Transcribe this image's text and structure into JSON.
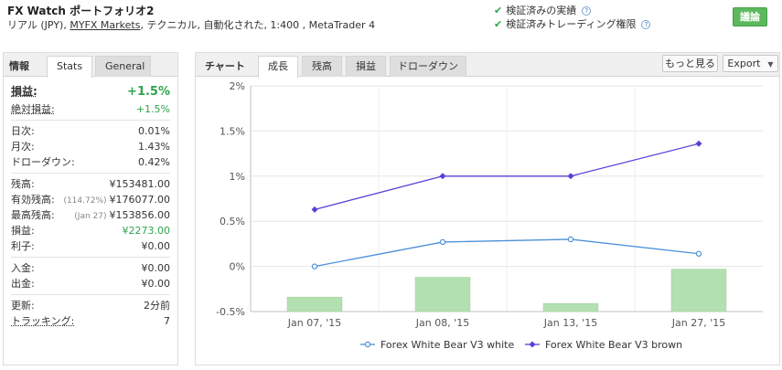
{
  "header": {
    "account_name": "FX Watch ポートフォリオ2",
    "meta_prefix": "リアル (JPY), ",
    "broker_link": "MYFX Markets",
    "meta_suffix": ", テクニカル, 自動化された, 1:400 , MetaTrader 4",
    "verifications": [
      "検証済みの実績",
      "検証済みトレーディング権限"
    ],
    "help_glyph": "?",
    "follow_button": "議論"
  },
  "left_panel": {
    "title": "情報",
    "tabs": [
      "Stats",
      "General"
    ],
    "stats": {
      "gain_label": "損益:",
      "gain_value": "+1.5%",
      "abs_gain_label": "絶対損益:",
      "abs_gain_value": "+1.5%",
      "daily_label": "日次:",
      "daily_value": "0.01%",
      "monthly_label": "月次:",
      "monthly_value": "1.43%",
      "drawdown_label": "ドローダウン:",
      "drawdown_value": "0.42%",
      "balance_label": "残高:",
      "balance_value": "¥153481.00",
      "equity_label": "有効残高:",
      "equity_pct": "(114.72%)",
      "equity_value": "¥176077.00",
      "highest_label": "最高残高:",
      "highest_date": "(Jan 27)",
      "highest_value": "¥153856.00",
      "profit_label": "損益:",
      "profit_value": "¥2273.00",
      "interest_label": "利子:",
      "interest_value": "¥0.00",
      "deposits_label": "入金:",
      "deposits_value": "¥0.00",
      "withdrawals_label": "出金:",
      "withdrawals_value": "¥0.00",
      "updated_label": "更新:",
      "updated_value": "2分前",
      "tracking_label": "トラッキング:",
      "tracking_value": "7"
    }
  },
  "chart_panel": {
    "title": "チャート",
    "tabs": [
      "成長",
      "残高",
      "損益",
      "ドローダウン"
    ],
    "more_button": "もっと見る",
    "export_button": "Export",
    "export_caret": "▼"
  },
  "chart_data": {
    "type": "line",
    "categories": [
      "Jan 07, '15",
      "Jan 08, '15",
      "Jan 13, '15",
      "Jan 27, '15"
    ],
    "yticks": [
      "2%",
      "1.5%",
      "1%",
      "0.5%",
      "0%",
      "-0.5%"
    ],
    "ylim": [
      -0.5,
      2
    ],
    "grid": true,
    "legend_position": "bottom",
    "series": [
      {
        "name": "Forex White Bear V3  white",
        "type": "line",
        "color": "#4a90d9",
        "marker": "circle",
        "values": [
          0.0,
          0.27,
          0.3,
          0.14
        ]
      },
      {
        "name": "Forex White Bear V3  brown",
        "type": "line",
        "color": "#5b3fd6",
        "marker": "diamond",
        "values": [
          0.63,
          1.0,
          1.0,
          1.36
        ]
      },
      {
        "type": "bar",
        "color": "#b2e0b0",
        "values": [
          -0.34,
          -0.12,
          -0.41,
          -0.03
        ]
      }
    ]
  }
}
